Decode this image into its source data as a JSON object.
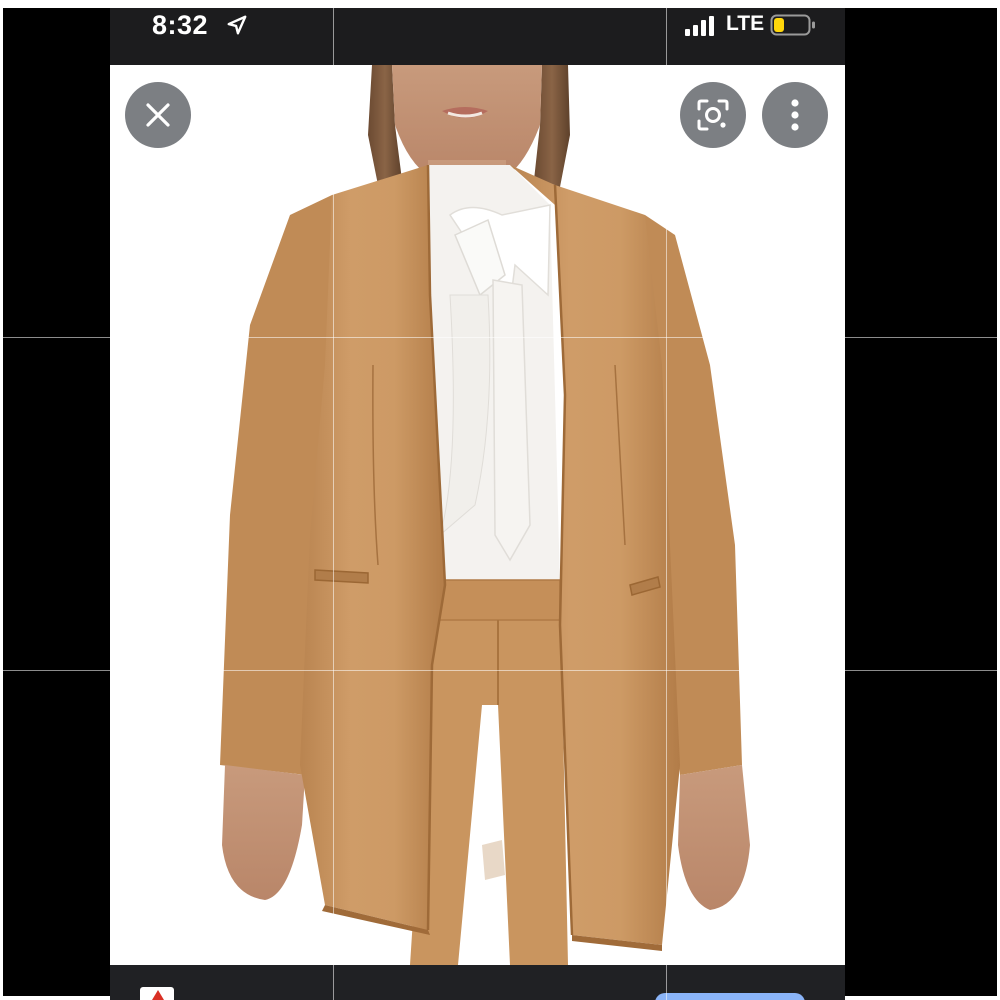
{
  "status_bar": {
    "time": "8:32",
    "network": "LTE",
    "icons": [
      "location-arrow-icon",
      "cellular-signal-icon",
      "battery-low-icon"
    ]
  },
  "viewer": {
    "controls": {
      "close": "close-icon",
      "lens": "lens-search-icon",
      "more": "more-vertical-icon"
    },
    "image": "camel-blazer-product-photo"
  },
  "colors": {
    "status_bar_bg": "#1c1c1e",
    "control_bg": "#5f6368",
    "blazer": "#c9955f",
    "blouse": "#f4f2ef",
    "battery_fill": "#ffd60a",
    "action_pill": "#8ab4f8"
  }
}
